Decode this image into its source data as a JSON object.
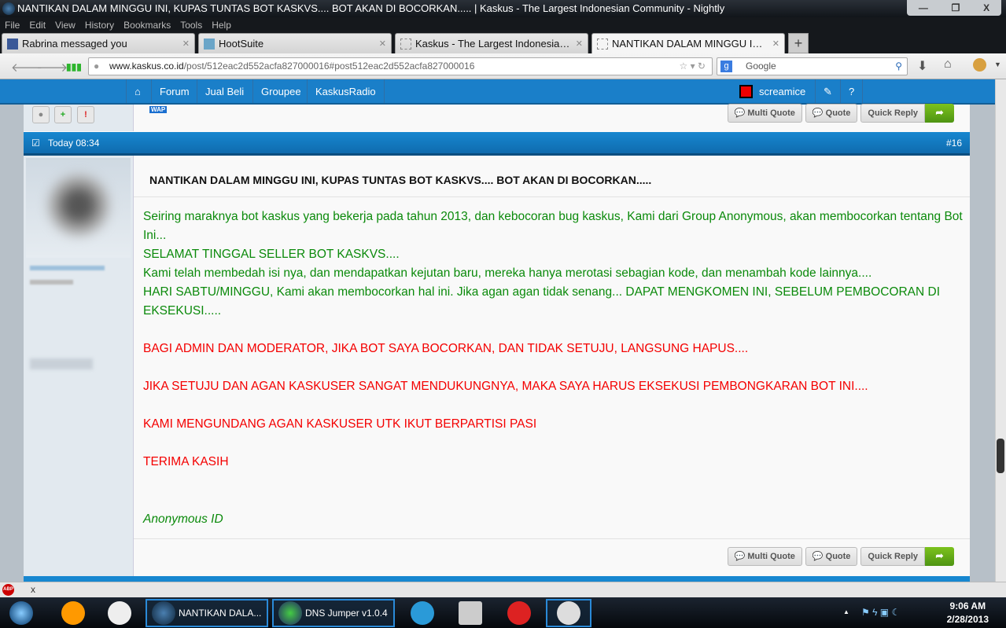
{
  "window": {
    "title": "NANTIKAN DALAM MINGGU INI, KUPAS TUNTAS BOT KASKVS.... BOT AKAN DI BOCORKAN..... | Kaskus - The Largest Indonesian Community - Nightly",
    "controls": [
      "—",
      "❐",
      "X"
    ]
  },
  "menu": [
    "File",
    "Edit",
    "View",
    "History",
    "Bookmarks",
    "Tools",
    "Help"
  ],
  "tabs": [
    {
      "label": "Rabrina messaged you"
    },
    {
      "label": "HootSuite"
    },
    {
      "label": "Kaskus - The Largest Indonesian Com..."
    },
    {
      "label": "NANTIKAN DALAM MINGGU INI, KU..."
    }
  ],
  "newtab": "+",
  "nav": {
    "url_domain": "www.kaskus.co.id",
    "url_path": "/post/512eac2d552acfa827000016#post512eac2d552acfa827000016",
    "search_placeholder": "Google"
  },
  "site": {
    "nav": [
      "Forum",
      "Jual Beli",
      "Groupee",
      "KaskusRadio"
    ],
    "user": "screamice"
  },
  "post": {
    "time": "Today 08:34",
    "number": "#16",
    "title": "NANTIKAN DALAM MINGGU INI, KUPAS TUNTAS BOT KASKVS.... BOT AKAN DI BOCORKAN.....",
    "lines": [
      {
        "text": "Seiring maraknya bot kaskus yang bekerja pada tahun 2013, dan kebocoran bug kaskus, Kami dari Group Anonymous, akan membocorkan tentang Bot Ini...",
        "color": "green"
      },
      {
        "text": "SELAMAT TINGGAL SELLER BOT KASKVS....",
        "color": "green"
      },
      {
        "text": "Kami telah membedah isi nya, dan mendapatkan kejutan baru, mereka hanya merotasi sebagian kode, dan menambah kode lainnya....",
        "color": "green"
      },
      {
        "text": "HARI SABTU/MINGGU, Kami akan membocorkan hal ini. Jika agan agan tidak senang... DAPAT MENGKOMEN INI, SEBELUM PEMBOCORAN DI EKSEKUSI.....",
        "color": "green"
      },
      {
        "text": "BAGI ADMIN DAN MODERATOR, JIKA BOT SAYA BOCORKAN, DAN TIDAK SETUJU, LANGSUNG HAPUS....",
        "color": "red"
      },
      {
        "text": "JIKA SETUJU DAN AGAN KASKUSER SANGAT MENDUKUNGNYA, MAKA SAYA HARUS EKSEKUSI PEMBONGKARAN BOT INI....",
        "color": "red"
      },
      {
        "text": "KAMI MENGUNDANG AGAN KASKUSER UTK IKUT BERPARTISI PASI",
        "color": "red"
      },
      {
        "text": "TERIMA KASIH",
        "color": "red"
      }
    ],
    "signature": "Anonymous ID"
  },
  "buttons": {
    "multi_quote": "Multi Quote",
    "quote": "Quote",
    "quick_reply": "Quick Reply",
    "wap": "WAP"
  },
  "addon": {
    "abp": "ABP",
    "close": "x"
  },
  "taskbar": {
    "items": [
      "NANTIKAN DALA...",
      "DNS Jumper v1.0.4"
    ],
    "time": "9:06 AM",
    "date": "2/28/2013"
  }
}
